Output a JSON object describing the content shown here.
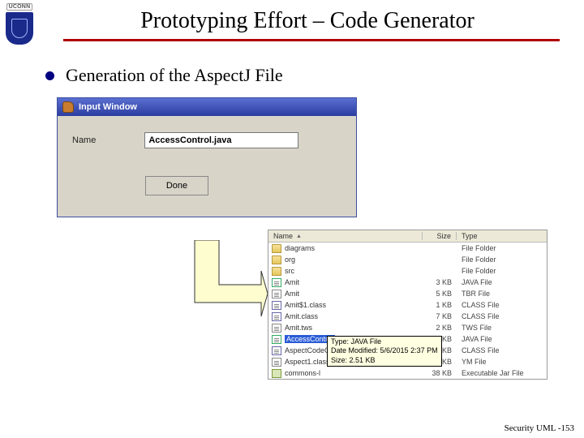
{
  "logo": {
    "org": "UCONN"
  },
  "slide": {
    "title": "Prototyping Effort – Code Generator",
    "bullet": "Generation of the AspectJ File"
  },
  "dialog": {
    "window_title": "Input Window",
    "name_label": "Name",
    "name_value": "AccessControl.java",
    "done_label": "Done"
  },
  "file_panel": {
    "columns": {
      "name": "Name",
      "size": "Size",
      "type": "Type"
    },
    "rows": [
      {
        "icon": "folder",
        "name": "diagrams",
        "size": "",
        "type": "File Folder"
      },
      {
        "icon": "folder",
        "name": "org",
        "size": "",
        "type": "File Folder"
      },
      {
        "icon": "folder",
        "name": "src",
        "size": "",
        "type": "File Folder"
      },
      {
        "icon": "java",
        "name": "Amit",
        "size": "3 KB",
        "type": "JAVA File"
      },
      {
        "icon": "file",
        "name": "Amit",
        "size": "5 KB",
        "type": "TBR File"
      },
      {
        "icon": "class",
        "name": "Amit$1.class",
        "size": "1 KB",
        "type": "CLASS File"
      },
      {
        "icon": "class",
        "name": "Amit.class",
        "size": "7 KB",
        "type": "CLASS File"
      },
      {
        "icon": "file",
        "name": "Amit.tws",
        "size": "2 KB",
        "type": "TWS File"
      },
      {
        "icon": "java",
        "name": "AccessControl",
        "size": "3 KB",
        "type": "JAVA File",
        "selected": true
      },
      {
        "icon": "class",
        "name": "AspectCodeGenerator.class",
        "size": "9 KB",
        "type": "CLASS File"
      },
      {
        "icon": "file",
        "name": "Aspect1.class",
        "size": "1 KB",
        "type": "YM File"
      },
      {
        "icon": "jar",
        "name": "commons-l",
        "size": "38 KB",
        "type": "Executable Jar File"
      }
    ],
    "tooltip": {
      "line1": "Type: JAVA File",
      "line2": "Date Modified: 5/6/2015 2:37 PM",
      "line3": "Size: 2.51 KB"
    }
  },
  "footer": "Security UML -153"
}
